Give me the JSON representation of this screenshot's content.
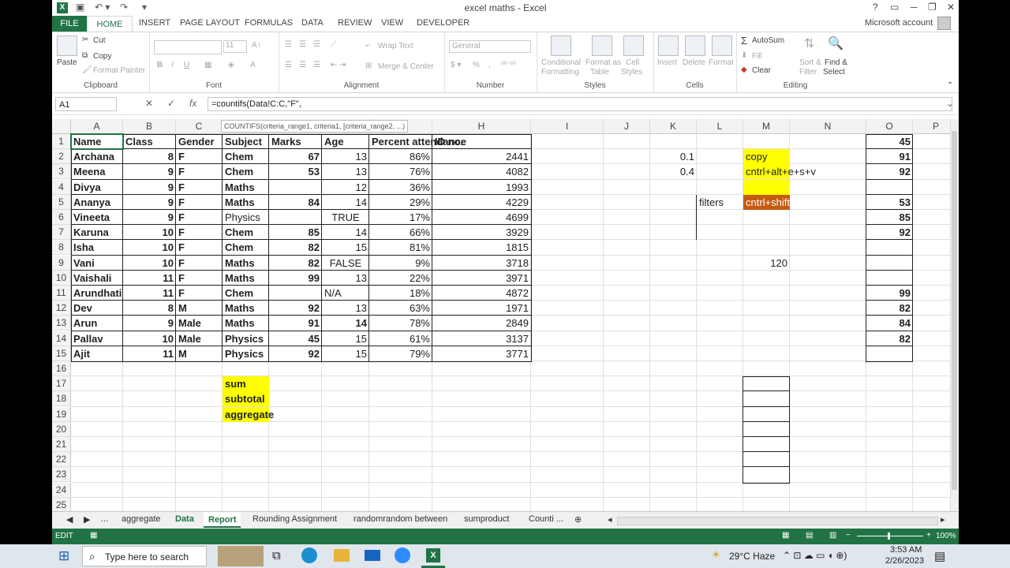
{
  "window": {
    "title": "excel maths - Excel",
    "account": "Microsoft account",
    "help": "?"
  },
  "ribbon_tabs": [
    "FILE",
    "HOME",
    "INSERT",
    "PAGE LAYOUT",
    "FORMULAS",
    "DATA",
    "REVIEW",
    "VIEW",
    "DEVELOPER"
  ],
  "ribbon": {
    "paste": "Paste",
    "cut": "Cut",
    "copy": "Copy",
    "format_painter": "Format Painter",
    "clipboard": "Clipboard",
    "font_size": "11",
    "font": "Font",
    "wrap_text": "Wrap Text",
    "merge_center": "Merge & Center",
    "alignment": "Alignment",
    "number_format": "General",
    "number": "Number",
    "conditional": "Conditional",
    "formatting": "Formatting",
    "format_as": "Format as",
    "table": "Table",
    "cell": "Cell",
    "styles_lbl": "Styles",
    "styles": "Styles",
    "insert": "Insert",
    "delete": "Delete",
    "format": "Format",
    "cells": "Cells",
    "autosum": "AutoSum",
    "fill": "Fill",
    "clear": "Clear",
    "sort": "Sort &",
    "filter": "Filter",
    "find": "Find &",
    "select": "Select",
    "editing": "Editing"
  },
  "formula_bar": {
    "name_box": "A1",
    "formula": "=countifs(Data!C:C,\"F\",",
    "tooltip": "COUNTIFS(criteria_range1, criteria1, [criteria_range2, ...)"
  },
  "columns": [
    "A",
    "B",
    "C",
    "D",
    "E",
    "F",
    "G",
    "H",
    "I",
    "J",
    "K",
    "L",
    "M",
    "N",
    "O",
    "P"
  ],
  "rows": [
    "1",
    "2",
    "3",
    "4",
    "5",
    "6",
    "7",
    "8",
    "9",
    "10",
    "11",
    "12",
    "13",
    "14",
    "15",
    "16",
    "17",
    "18",
    "19",
    "20",
    "21",
    "22",
    "23",
    "24",
    "25"
  ],
  "table": {
    "headers": [
      "Name",
      "Class",
      "Gender",
      "Subject",
      "Marks",
      "Age",
      "Percent attendance",
      "ID no."
    ],
    "rows": [
      [
        "Archana",
        "8",
        "F",
        "Chem",
        "67",
        "13",
        "86%",
        "2441"
      ],
      [
        "Meena",
        "9",
        "F",
        "Chem",
        "53",
        "13",
        "76%",
        "4082"
      ],
      [
        "Divya",
        "9",
        "F",
        "Maths",
        "",
        "12",
        "36%",
        "1993"
      ],
      [
        "Ananya",
        "9",
        "F",
        "Maths",
        "84",
        "14",
        "29%",
        "4229"
      ],
      [
        "Vineeta",
        "9",
        "F",
        "Physics",
        "",
        "TRUE",
        "17%",
        "4699"
      ],
      [
        "Karuna",
        "10",
        "F",
        "Chem",
        "85",
        "14",
        "66%",
        "3929"
      ],
      [
        "Isha",
        "10",
        "F",
        "Chem",
        "82",
        "15",
        "81%",
        "1815"
      ],
      [
        "Vani",
        "10",
        "F",
        "Maths",
        "82",
        "FALSE",
        "9%",
        "3718"
      ],
      [
        "Vaishali",
        "11",
        "F",
        "Maths",
        "99",
        "13",
        "22%",
        "3971"
      ],
      [
        "Arundhati",
        "11",
        "F",
        "Chem",
        "",
        "N/A",
        "18%",
        "4872"
      ],
      [
        "Dev",
        "8",
        "M",
        "Maths",
        "92",
        "13",
        "63%",
        "1971"
      ],
      [
        "Arun",
        "9",
        "Male",
        "Maths",
        "91",
        "14",
        "78%",
        "2849"
      ],
      [
        "Pallav",
        "10",
        "Male",
        "Physics",
        "45",
        "15",
        "61%",
        "3137"
      ],
      [
        "Ajit",
        "11",
        "M",
        "Physics",
        "92",
        "15",
        "79%",
        "3771"
      ]
    ]
  },
  "notes": {
    "k2": "0.1",
    "k3": "0.4",
    "m2": "copy",
    "m3": "cntrl+alt+e+s+v",
    "l5": "filters",
    "m5": "cntrl+shift+L",
    "m9": "120"
  },
  "col_o": [
    "45",
    "91",
    "92",
    "",
    "53",
    "85",
    "92",
    "",
    "",
    "",
    "99",
    "82",
    "84",
    "82",
    ""
  ],
  "d_notes": [
    "sum",
    "subtotal",
    "aggregate"
  ],
  "sheet_tabs": [
    "...",
    "aggregate",
    "Data",
    "Report",
    "Rounding Assignment",
    "randomrandom between",
    "sumproduct",
    "Counti ..."
  ],
  "status": {
    "mode": "EDIT",
    "zoom": "100%"
  },
  "taskbar": {
    "search": "Type here to search",
    "weather": "29°C  Haze",
    "time": "3:53 AM",
    "date": "2/26/2023"
  },
  "colors": {
    "excel_green": "#217346",
    "yellow": "#ffff00",
    "orange": "#c55a11"
  }
}
